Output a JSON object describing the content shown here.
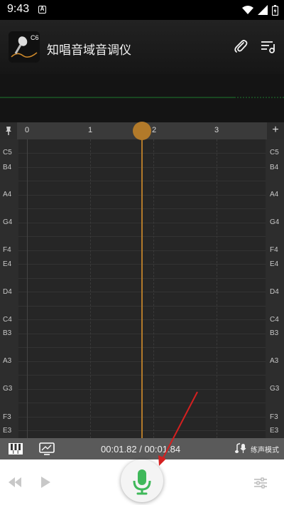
{
  "status_bar": {
    "time": "9:43",
    "icons": [
      "wifi-icon",
      "signal-icon",
      "battery-icon"
    ]
  },
  "app": {
    "title": "知唱音域音调仪",
    "logo_text": "C6"
  },
  "ruler": {
    "ticks": [
      "0",
      "1",
      "2",
      "3"
    ],
    "plus_label": "+"
  },
  "notes": [
    "C5",
    "B4",
    "A4",
    "G4",
    "F4",
    "E4",
    "D4",
    "C4",
    "B3",
    "A3",
    "G3",
    "F3",
    "E3"
  ],
  "playback": {
    "time_readout": "00:01.82 / 00:01.84",
    "mode_label": "练声模式"
  },
  "colors": {
    "accent_orange": "#b27a2a",
    "mic_green": "#3fb85a",
    "pitch_line": "#1e7a2e",
    "annotation_red": "#d42020"
  }
}
